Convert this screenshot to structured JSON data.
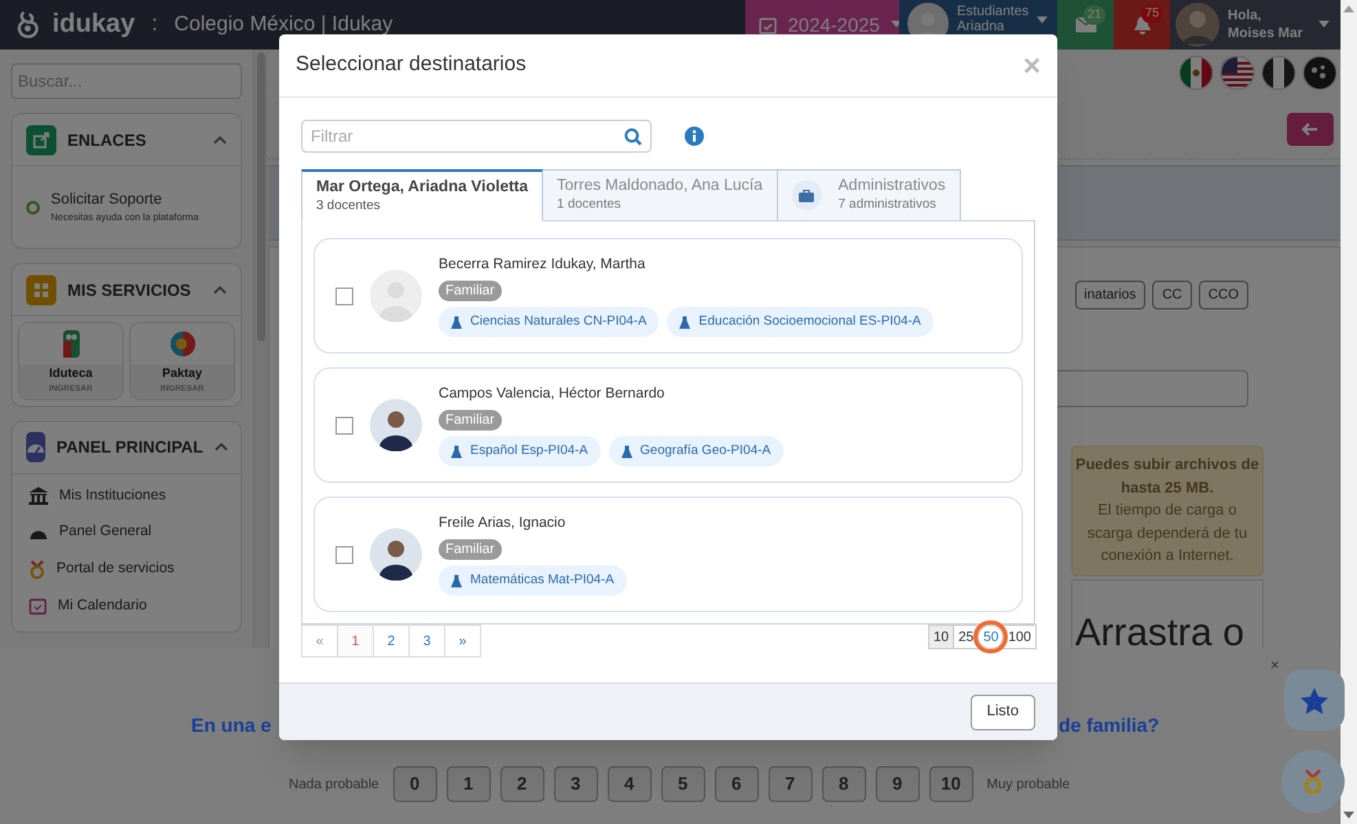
{
  "topbar": {
    "brand": "idukay",
    "separator": ":",
    "school": "Colegio México | Idukay",
    "year": "2024-2025",
    "student_label": "Estudiantes",
    "student_name": "Ariadna",
    "messages_count": "21",
    "notifications_count": "75",
    "greeting": "Hola,",
    "user_name": "Moises Mar"
  },
  "sidebar": {
    "search_placeholder": "Buscar...",
    "sections": [
      {
        "kind": "links",
        "title": "ENLACES",
        "expanded": true,
        "items": [
          {
            "title": "Solicitar Soporte",
            "subtitle": "Necesitas ayuda con la plataforma"
          }
        ]
      },
      {
        "kind": "services",
        "title": "MIS SERVICIOS",
        "expanded": true,
        "items": [
          {
            "title": "Iduteca",
            "action": "INGRESAR"
          },
          {
            "title": "Paktay",
            "action": "INGRESAR"
          }
        ]
      },
      {
        "kind": "menu",
        "title": "PANEL PRINCIPAL",
        "expanded": true,
        "items": [
          {
            "title": "Mis Instituciones"
          },
          {
            "title": "Panel General"
          },
          {
            "title": "Portal de servicios"
          },
          {
            "title": "Mi Calendario"
          }
        ]
      }
    ]
  },
  "main": {
    "recipient_buttons": [
      "inatarios",
      "CC",
      "CCO"
    ],
    "notice_lines": [
      "Puedes subir archivos de",
      "hasta 25 MB.",
      "El tiempo de carga o",
      "scarga dependerá de tu",
      "conexión a Internet."
    ],
    "dropzone_text": "Arrastra o"
  },
  "survey": {
    "question_start": "En una e",
    "question_end": "de familia?",
    "low_label": "Nada probable",
    "high_label": "Muy probable",
    "scores": [
      "0",
      "1",
      "2",
      "3",
      "4",
      "5",
      "6",
      "7",
      "8",
      "9",
      "10"
    ],
    "close": "×"
  },
  "modal": {
    "title": "Seleccionar destinatarios",
    "close": "×",
    "filter_placeholder": "Filtrar",
    "tabs": [
      {
        "kind": "teacher",
        "title": "Mar Ortega, Ariadna Violetta",
        "subtitle": "3 docentes",
        "selected": true
      },
      {
        "kind": "teacher",
        "title": "Torres Maldonado, Ana Lucía",
        "subtitle": "1 docentes",
        "selected": false
      },
      {
        "kind": "admin",
        "title": "Administrativos",
        "subtitle": "7 administrativos",
        "selected": false
      }
    ],
    "people": [
      {
        "kind": "placeholder",
        "name": "Becerra Ramirez Idukay, Martha",
        "role": "Familiar",
        "checked": false,
        "subjects": [
          "Ciencias Naturales CN-PI04-A",
          "Educación Socioemocional ES-PI04-A"
        ]
      },
      {
        "kind": "photo",
        "name": "Campos Valencia, Héctor Bernardo",
        "role": "Familiar",
        "checked": false,
        "subjects": [
          "Español Esp-PI04-A",
          "Geografía Geo-PI04-A"
        ]
      },
      {
        "kind": "photo",
        "name": "Freile Arias, Ignacio",
        "role": "Familiar",
        "checked": false,
        "subjects": [
          "Matemáticas Mat-PI04-A"
        ]
      }
    ],
    "pages": [
      {
        "label": "«",
        "selected": false
      },
      {
        "label": "1",
        "selected": true
      },
      {
        "label": "2",
        "selected": false
      },
      {
        "label": "3",
        "selected": false
      },
      {
        "label": "»",
        "selected": false
      }
    ],
    "page_sizes": [
      {
        "label": "10",
        "selected": true,
        "highlighted": false
      },
      {
        "label": "25",
        "selected": false,
        "highlighted": false
      },
      {
        "label": "50",
        "selected": false,
        "highlighted": true
      },
      {
        "label": "100",
        "selected": false,
        "highlighted": false
      }
    ],
    "done_button": "Listo"
  }
}
